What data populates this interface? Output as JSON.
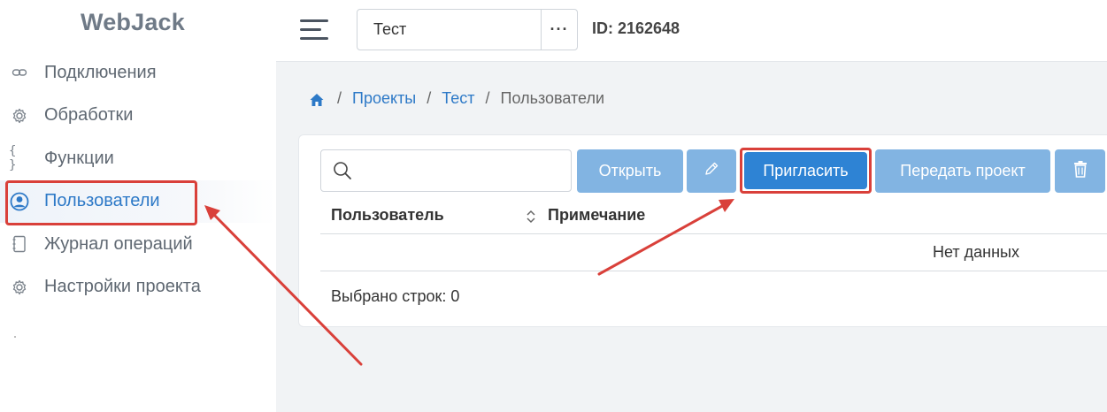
{
  "app": {
    "title": "WebJack"
  },
  "sidebar": {
    "items": [
      {
        "label": "Подключения",
        "icon": "link-icon",
        "active": false
      },
      {
        "label": "Обработки",
        "icon": "gear-icon",
        "active": false
      },
      {
        "label": "Функции",
        "icon": "braces-icon",
        "active": false
      },
      {
        "label": "Пользователи",
        "icon": "user-circle-icon",
        "active": true
      },
      {
        "label": "Журнал операций",
        "icon": "notebook-icon",
        "active": false
      },
      {
        "label": "Настройки проекта",
        "icon": "gear-icon",
        "active": false
      }
    ]
  },
  "header": {
    "project_value": "Тест",
    "more_label": "···",
    "project_id": "ID: 2162648"
  },
  "breadcrumb": {
    "separator": "/",
    "items": [
      "Проекты",
      "Тест"
    ],
    "current": "Пользователи"
  },
  "toolbar": {
    "search_placeholder": "",
    "open_label": "Открыть",
    "invite_label": "Пригласить",
    "transfer_label": "Передать проект"
  },
  "table": {
    "columns": [
      "Пользователь",
      "Примечание"
    ],
    "empty_text": "Нет данных",
    "selected_text": "Выбрано строк: 0"
  },
  "colors": {
    "accent": "#2e83d4",
    "button_disabled": "#82b4e2",
    "annotation": "#d9403a",
    "link": "#2d79c7"
  }
}
